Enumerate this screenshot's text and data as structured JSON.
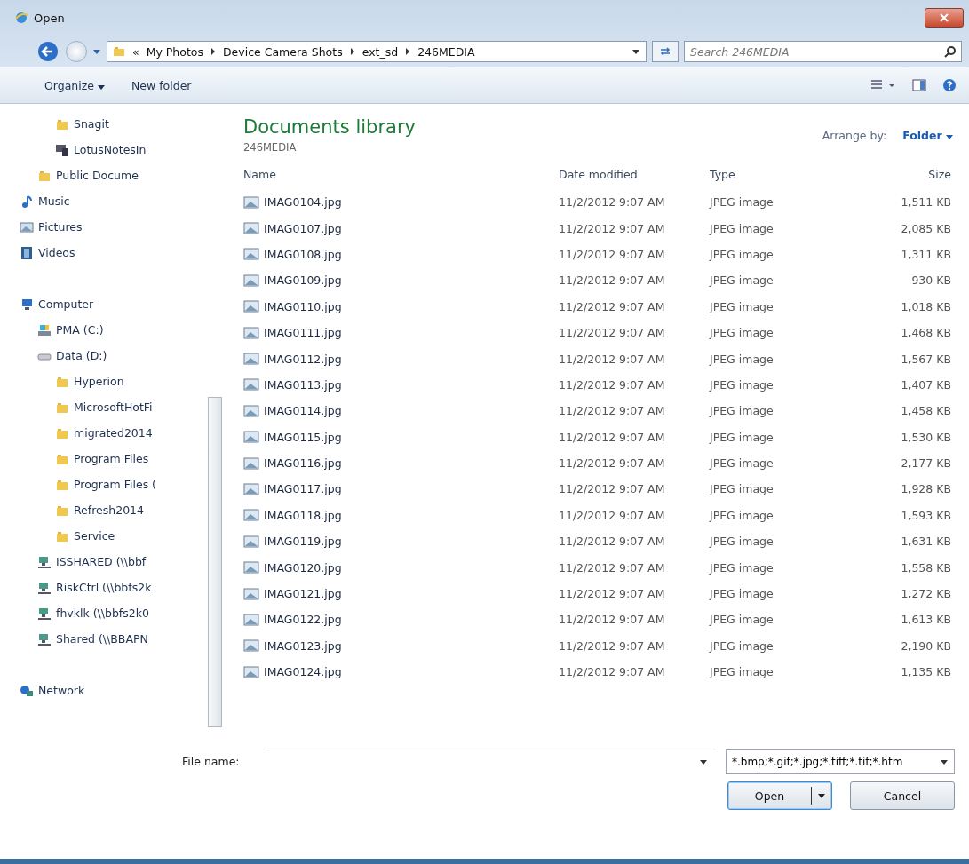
{
  "window": {
    "title": "Open"
  },
  "address": {
    "overflow": "«",
    "crumbs": [
      "My Photos",
      "Device Camera Shots",
      "ext_sd",
      "246MEDIA"
    ],
    "search_placeholder": "Search 246MEDIA"
  },
  "toolbar": {
    "organize": "Organize",
    "new_folder": "New folder"
  },
  "sidebar": {
    "partial_depth2": [
      {
        "label": "Snagit",
        "kind": "folder"
      },
      {
        "label": "LotusNotesIn",
        "kind": "app"
      }
    ],
    "partial_depth1": [
      {
        "label": "Public Docume",
        "kind": "folder"
      }
    ],
    "items": [
      {
        "label": "Music",
        "kind": "music"
      },
      {
        "label": "Pictures",
        "kind": "pictures"
      },
      {
        "label": "Videos",
        "kind": "videos"
      },
      {
        "kind": "gap"
      },
      {
        "label": "Computer",
        "kind": "computer",
        "children": [
          {
            "label": "PMA (C:)",
            "kind": "system-drive"
          },
          {
            "label": "Data (D:)",
            "kind": "drive",
            "children": [
              {
                "label": "Hyperion",
                "kind": "folder"
              },
              {
                "label": "MicrosoftHotFi",
                "kind": "folder"
              },
              {
                "label": "migrated2014",
                "kind": "folder"
              },
              {
                "label": "Program Files",
                "kind": "folder"
              },
              {
                "label": "Program Files (",
                "kind": "folder"
              },
              {
                "label": "Refresh2014",
                "kind": "folder"
              },
              {
                "label": "Service",
                "kind": "folder"
              }
            ]
          },
          {
            "label": "ISSHARED (\\\\bbf",
            "kind": "network-drive"
          },
          {
            "label": "RiskCtrl (\\\\bbfs2k",
            "kind": "network-drive"
          },
          {
            "label": "fhvklk (\\\\bbfs2k0",
            "kind": "network-drive"
          },
          {
            "label": "Shared (\\\\BBAPN",
            "kind": "network-drive"
          }
        ]
      },
      {
        "kind": "gap"
      },
      {
        "label": "Network",
        "kind": "network"
      }
    ]
  },
  "library": {
    "title": "Documents library",
    "subtitle": "246MEDIA",
    "arrange_label": "Arrange by:",
    "arrange_value": "Folder"
  },
  "table": {
    "columns": [
      "Name",
      "Date modified",
      "Type",
      "Size"
    ],
    "rows": [
      [
        "IMAG0104.jpg",
        "11/2/2012 9:07 AM",
        "JPEG image",
        "1,511 KB"
      ],
      [
        "IMAG0107.jpg",
        "11/2/2012 9:07 AM",
        "JPEG image",
        "2,085 KB"
      ],
      [
        "IMAG0108.jpg",
        "11/2/2012 9:07 AM",
        "JPEG image",
        "1,311 KB"
      ],
      [
        "IMAG0109.jpg",
        "11/2/2012 9:07 AM",
        "JPEG image",
        "930 KB"
      ],
      [
        "IMAG0110.jpg",
        "11/2/2012 9:07 AM",
        "JPEG image",
        "1,018 KB"
      ],
      [
        "IMAG0111.jpg",
        "11/2/2012 9:07 AM",
        "JPEG image",
        "1,468 KB"
      ],
      [
        "IMAG0112.jpg",
        "11/2/2012 9:07 AM",
        "JPEG image",
        "1,567 KB"
      ],
      [
        "IMAG0113.jpg",
        "11/2/2012 9:07 AM",
        "JPEG image",
        "1,407 KB"
      ],
      [
        "IMAG0114.jpg",
        "11/2/2012 9:07 AM",
        "JPEG image",
        "1,458 KB"
      ],
      [
        "IMAG0115.jpg",
        "11/2/2012 9:07 AM",
        "JPEG image",
        "1,530 KB"
      ],
      [
        "IMAG0116.jpg",
        "11/2/2012 9:07 AM",
        "JPEG image",
        "2,177 KB"
      ],
      [
        "IMAG0117.jpg",
        "11/2/2012 9:07 AM",
        "JPEG image",
        "1,928 KB"
      ],
      [
        "IMAG0118.jpg",
        "11/2/2012 9:07 AM",
        "JPEG image",
        "1,593 KB"
      ],
      [
        "IMAG0119.jpg",
        "11/2/2012 9:07 AM",
        "JPEG image",
        "1,631 KB"
      ],
      [
        "IMAG0120.jpg",
        "11/2/2012 9:07 AM",
        "JPEG image",
        "1,558 KB"
      ],
      [
        "IMAG0121.jpg",
        "11/2/2012 9:07 AM",
        "JPEG image",
        "1,272 KB"
      ],
      [
        "IMAG0122.jpg",
        "11/2/2012 9:07 AM",
        "JPEG image",
        "1,613 KB"
      ],
      [
        "IMAG0123.jpg",
        "11/2/2012 9:07 AM",
        "JPEG image",
        "2,190 KB"
      ],
      [
        "IMAG0124.jpg",
        "11/2/2012 9:07 AM",
        "JPEG image",
        "1,135 KB"
      ]
    ]
  },
  "footer": {
    "file_name_label": "File name:",
    "filter": "*.bmp;*.gif;*.jpg;*.tiff;*.tif;*.htm",
    "open": "Open",
    "cancel": "Cancel"
  }
}
